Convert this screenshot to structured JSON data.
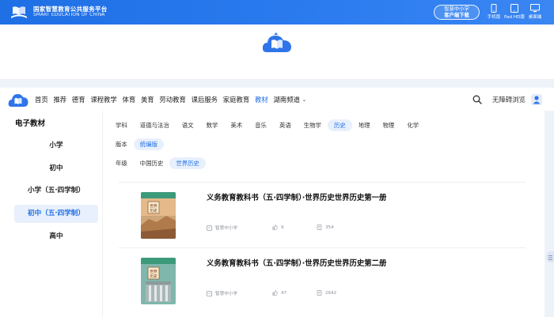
{
  "header": {
    "logo_cn": "国家智慧教育公共服务平台",
    "logo_en": "SMART EDUCATION OF CHINA",
    "download_line1": "智慧中小学",
    "download_line2": "客户端下载",
    "devices": [
      {
        "label": "手机版",
        "icon": "phone-icon"
      },
      {
        "label": "Pad HD版",
        "icon": "tablet-icon"
      },
      {
        "label": "桌面端",
        "icon": "desktop-icon"
      }
    ],
    "brand_color": "#1f6fe5"
  },
  "nav": {
    "items": [
      "首页",
      "推荐",
      "德育",
      "课程教学",
      "体育",
      "美育",
      "劳动教育",
      "课后服务",
      "家庭教育",
      "教材",
      "湖南频道"
    ],
    "active_index": 9,
    "accessibility_label": "无障碍浏览"
  },
  "sidebar": {
    "title": "电子教材",
    "items": [
      "小学",
      "初中",
      "小学（五·四学制）",
      "初中（五·四学制）",
      "高中"
    ],
    "active_index": 3
  },
  "filters": {
    "subjects": [
      "学科",
      "道德与法治",
      "语文",
      "数学",
      "美术",
      "音乐",
      "英语",
      "生物学",
      "历史",
      "地理",
      "物理",
      "化学"
    ],
    "subject_selected": "历史",
    "edition_label": "版本",
    "editions": [
      "统编版"
    ],
    "grade_label": "年级",
    "grades": [
      "中国历史",
      "世界历史"
    ],
    "grade_selected": "世界历史"
  },
  "books": [
    {
      "title": "义务教育教科书（五·四学制）·世界历史世界历史第一册",
      "publisher": "智慧中小学",
      "likes": "9",
      "views": "354"
    },
    {
      "title": "义务教育教科书（五·四学制）·世界历史世界历史第二册",
      "publisher": "智慧中小学",
      "likes": "47",
      "views": "2642"
    }
  ]
}
